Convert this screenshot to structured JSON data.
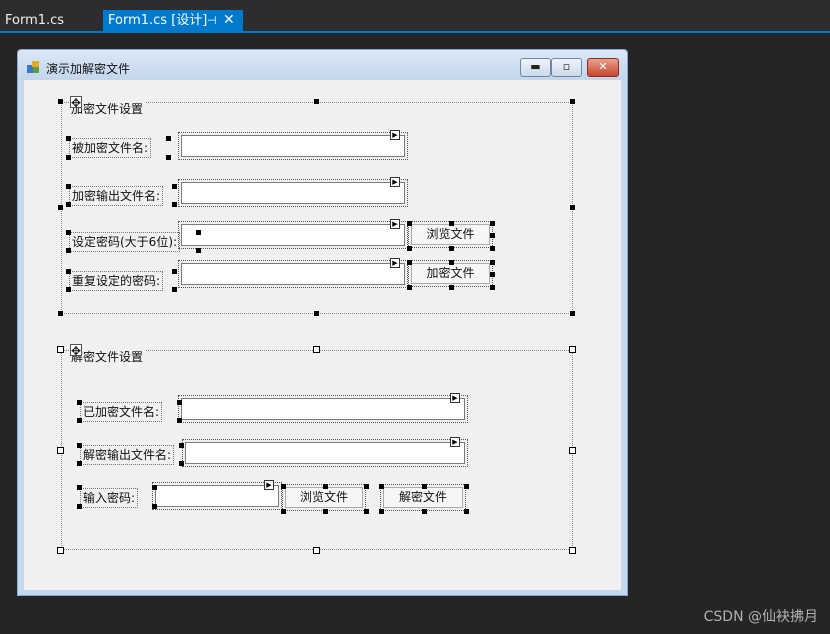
{
  "editor": {
    "tabs": [
      {
        "label": "Form1.cs"
      },
      {
        "label": "Form1.cs [设计]",
        "pin_glyph": "⊣",
        "close_glyph": "✕"
      }
    ]
  },
  "form": {
    "title": "演示加解密文件",
    "window_buttons": {
      "minimize": "▬",
      "maximize": "▫",
      "close": "✕"
    },
    "encrypt_group": {
      "legend": "加密文件设置",
      "source_label": "被加密文件名:",
      "output_label": "加密输出文件名:",
      "password_label": "设定密码(大于6位):",
      "confirm_label": "重复设定的密码:",
      "browse_button": "浏览文件",
      "encrypt_button": "加密文件"
    },
    "decrypt_group": {
      "legend": "解密文件设置",
      "encrypted_label": "已加密文件名:",
      "output_label": "解密输出文件名:",
      "password_label": "输入密码:",
      "browse_button": "浏览文件",
      "decrypt_button": "解密文件"
    }
  },
  "watermark": "CSDN @仙袂拂月",
  "icons": [
    "app-icon",
    "move-icon",
    "smart-tag-arrow-icon",
    "pin-icon",
    "close-icon"
  ]
}
